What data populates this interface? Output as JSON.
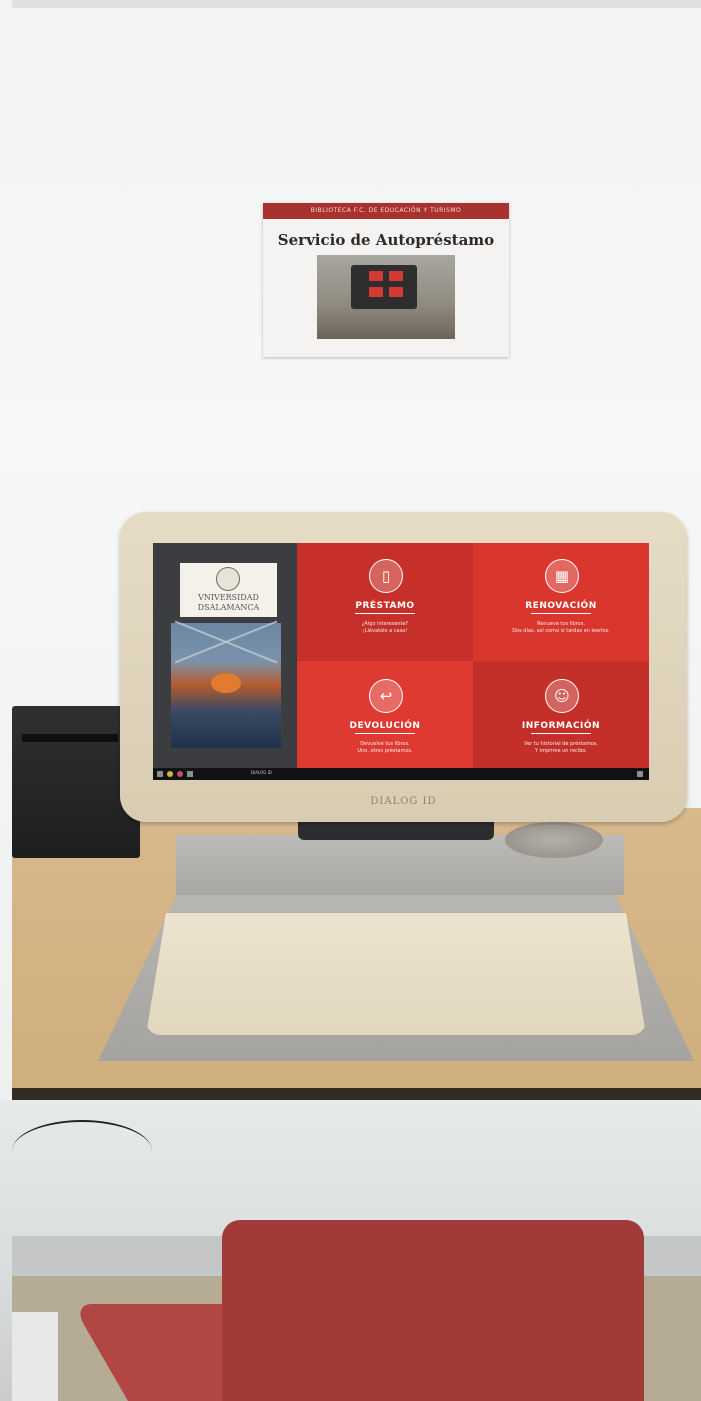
{
  "poster": {
    "header": "BIBLIOTECA F.C. DE EDUCACIÓN Y TURISMO",
    "title": "Servicio de Autopréstamo"
  },
  "kiosk": {
    "brand": "DIALOG ID",
    "university_logo": [
      "VNIVERSIDAD",
      "DSALAMANCA"
    ],
    "tiles": [
      {
        "icon": "book-icon",
        "title": "PRÉSTAMO",
        "desc": [
          "¿Algo interesante?",
          "¡Llévatelo a casa!"
        ]
      },
      {
        "icon": "calendar-icon",
        "title": "RENOVACIÓN",
        "desc": [
          "Renueva tus libros.",
          "Dos días, así como si tardas en leerlos."
        ]
      },
      {
        "icon": "return-icon",
        "title": "DEVOLUCIÓN",
        "desc": [
          "Devuelve tus libros.",
          "Uno, otros préstamos."
        ]
      },
      {
        "icon": "user-icon",
        "title": "INFORMACIÓN",
        "desc": [
          "Ver tu historial de préstamos.",
          "Y imprime un recibo."
        ]
      }
    ],
    "taskbar_label": "DIALOG ID"
  }
}
